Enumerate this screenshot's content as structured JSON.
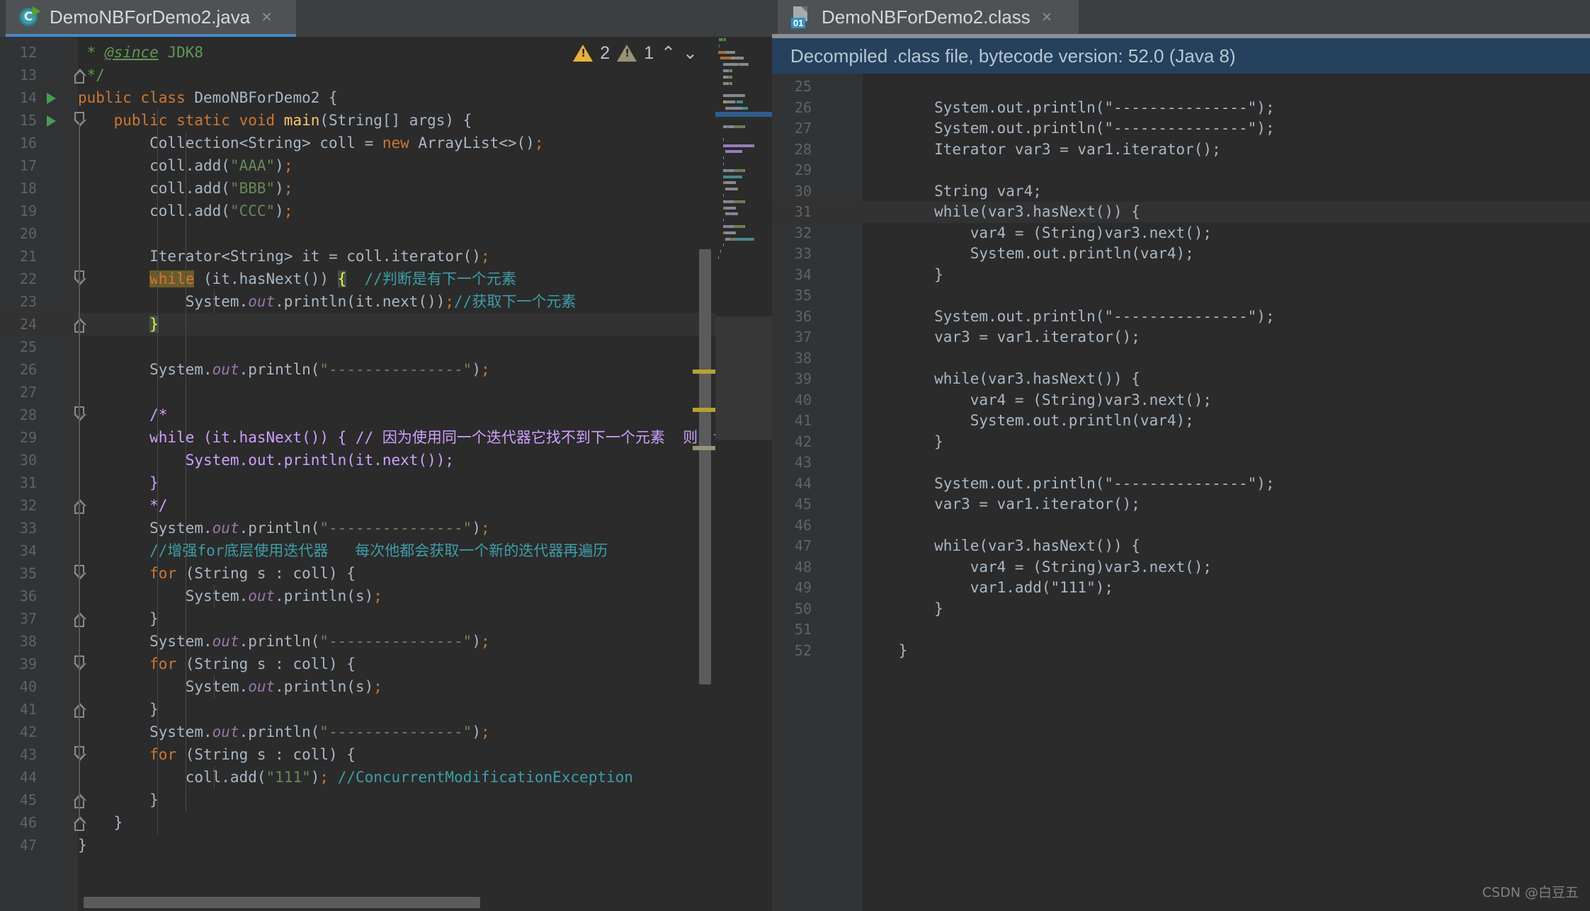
{
  "left": {
    "tab": {
      "label": "DemoNBForDemo2.java",
      "icon": "java-class-icon",
      "close": "×"
    },
    "warnings": {
      "error_count": "2",
      "weak_count": "1",
      "up": "⌃",
      "down": "⌄"
    },
    "first_line_number": 12,
    "lines": [
      {
        "n": 12,
        "frag": [
          {
            "t": " * ",
            "c": "doc"
          },
          {
            "t": "@since",
            "c": "doctag"
          },
          {
            "t": " JDK8",
            "c": "doc"
          }
        ]
      },
      {
        "n": 13,
        "frag": [
          {
            "t": " */",
            "c": "doc"
          }
        ],
        "fold": "arrowup"
      },
      {
        "n": 14,
        "frag": [
          {
            "t": "public class ",
            "c": "kw"
          },
          {
            "t": "DemoNBForDemo2 {",
            "c": "cls"
          }
        ],
        "run": true
      },
      {
        "n": 15,
        "frag": [
          {
            "t": "    ",
            "c": "cls"
          },
          {
            "t": "public static void ",
            "c": "kw"
          },
          {
            "t": "main",
            "c": "mth"
          },
          {
            "t": "(String[] args) {",
            "c": "cls"
          }
        ],
        "run": true,
        "fold": "arrowdown"
      },
      {
        "n": 16,
        "frag": [
          {
            "t": "        Collection<String> coll = ",
            "c": "cls"
          },
          {
            "t": "new ",
            "c": "kw"
          },
          {
            "t": "ArrayList<>()",
            "c": "cls"
          },
          {
            "t": ";",
            "c": "semi"
          }
        ]
      },
      {
        "n": 17,
        "frag": [
          {
            "t": "        coll.add(",
            "c": "cls"
          },
          {
            "t": "\"AAA\"",
            "c": "str"
          },
          {
            "t": ")",
            "c": "cls"
          },
          {
            "t": ";",
            "c": "semi"
          }
        ]
      },
      {
        "n": 18,
        "frag": [
          {
            "t": "        coll.add(",
            "c": "cls"
          },
          {
            "t": "\"BBB\"",
            "c": "str"
          },
          {
            "t": ")",
            "c": "cls"
          },
          {
            "t": ";",
            "c": "semi"
          }
        ]
      },
      {
        "n": 19,
        "frag": [
          {
            "t": "        coll.add(",
            "c": "cls"
          },
          {
            "t": "\"CCC\"",
            "c": "str"
          },
          {
            "t": ")",
            "c": "cls"
          },
          {
            "t": ";",
            "c": "semi"
          }
        ]
      },
      {
        "n": 20,
        "frag": []
      },
      {
        "n": 21,
        "frag": [
          {
            "t": "        Iterator<String> it = coll.iterator()",
            "c": "cls"
          },
          {
            "t": ";",
            "c": "semi"
          }
        ]
      },
      {
        "n": 22,
        "frag": [
          {
            "t": "        ",
            "c": "cls"
          },
          {
            "t": "while",
            "c": "whilehl"
          },
          {
            "t": " (it.hasNext()) ",
            "c": "cls"
          },
          {
            "t": "{",
            "c": "bracehl"
          },
          {
            "t": "  ",
            "c": "cls"
          },
          {
            "t": "//判断是有下一个元素",
            "c": "cmt2"
          }
        ],
        "fold": "arrowdown"
      },
      {
        "n": 23,
        "frag": [
          {
            "t": "            System.",
            "c": "cls"
          },
          {
            "t": "out",
            "c": "fld"
          },
          {
            "t": ".println(it.next())",
            "c": "cls"
          },
          {
            "t": ";",
            "c": "semi"
          },
          {
            "t": "//获取下一个元素",
            "c": "cmt2"
          }
        ]
      },
      {
        "n": 24,
        "frag": [
          {
            "t": "        ",
            "c": "cls"
          },
          {
            "t": "}",
            "c": "bracehl"
          }
        ],
        "fold": "arrowup",
        "hl": true
      },
      {
        "n": 25,
        "frag": []
      },
      {
        "n": 26,
        "frag": [
          {
            "t": "        System.",
            "c": "cls"
          },
          {
            "t": "out",
            "c": "fld"
          },
          {
            "t": ".println(",
            "c": "cls"
          },
          {
            "t": "\"---------------\"",
            "c": "str"
          },
          {
            "t": ")",
            "c": "cls"
          },
          {
            "t": ";",
            "c": "semi"
          }
        ]
      },
      {
        "n": 27,
        "frag": []
      },
      {
        "n": 28,
        "frag": [
          {
            "t": "        /*",
            "c": "cmtblk"
          }
        ],
        "fold": "arrowdown"
      },
      {
        "n": 29,
        "frag": [
          {
            "t": "        while (it.hasNext()) { // 因为使用同一个迭代器它找不到下一个元素  则为false",
            "c": "cmtblk"
          }
        ]
      },
      {
        "n": 30,
        "frag": [
          {
            "t": "            System.out.println(it.next());",
            "c": "cmtblk"
          }
        ]
      },
      {
        "n": 31,
        "frag": [
          {
            "t": "        }",
            "c": "cmtblk"
          }
        ]
      },
      {
        "n": 32,
        "frag": [
          {
            "t": "        */",
            "c": "cmtblk"
          }
        ],
        "fold": "arrowup"
      },
      {
        "n": 33,
        "frag": [
          {
            "t": "        System.",
            "c": "cls"
          },
          {
            "t": "out",
            "c": "fld"
          },
          {
            "t": ".println(",
            "c": "cls"
          },
          {
            "t": "\"---------------\"",
            "c": "str"
          },
          {
            "t": ")",
            "c": "cls"
          },
          {
            "t": ";",
            "c": "semi"
          }
        ]
      },
      {
        "n": 34,
        "frag": [
          {
            "t": "        //增强for底层使用迭代器   每次他都会获取一个新的迭代器再遍历",
            "c": "cmt2"
          }
        ]
      },
      {
        "n": 35,
        "frag": [
          {
            "t": "        ",
            "c": "cls"
          },
          {
            "t": "for ",
            "c": "kw"
          },
          {
            "t": "(String s : coll) {",
            "c": "cls"
          }
        ],
        "fold": "arrowdown"
      },
      {
        "n": 36,
        "frag": [
          {
            "t": "            System.",
            "c": "cls"
          },
          {
            "t": "out",
            "c": "fld"
          },
          {
            "t": ".println(s)",
            "c": "cls"
          },
          {
            "t": ";",
            "c": "semi"
          }
        ]
      },
      {
        "n": 37,
        "frag": [
          {
            "t": "        }",
            "c": "cls"
          }
        ],
        "fold": "arrowup"
      },
      {
        "n": 38,
        "frag": [
          {
            "t": "        System.",
            "c": "cls"
          },
          {
            "t": "out",
            "c": "fld"
          },
          {
            "t": ".println(",
            "c": "cls"
          },
          {
            "t": "\"---------------\"",
            "c": "str"
          },
          {
            "t": ")",
            "c": "cls"
          },
          {
            "t": ";",
            "c": "semi"
          }
        ]
      },
      {
        "n": 39,
        "frag": [
          {
            "t": "        ",
            "c": "cls"
          },
          {
            "t": "for ",
            "c": "kw"
          },
          {
            "t": "(String s : coll) {",
            "c": "cls"
          }
        ],
        "fold": "arrowdown"
      },
      {
        "n": 40,
        "frag": [
          {
            "t": "            System.",
            "c": "cls"
          },
          {
            "t": "out",
            "c": "fld"
          },
          {
            "t": ".println(s)",
            "c": "cls"
          },
          {
            "t": ";",
            "c": "semi"
          }
        ]
      },
      {
        "n": 41,
        "frag": [
          {
            "t": "        }",
            "c": "cls"
          }
        ],
        "fold": "arrowup"
      },
      {
        "n": 42,
        "frag": [
          {
            "t": "        System.",
            "c": "cls"
          },
          {
            "t": "out",
            "c": "fld"
          },
          {
            "t": ".println(",
            "c": "cls"
          },
          {
            "t": "\"---------------\"",
            "c": "str"
          },
          {
            "t": ")",
            "c": "cls"
          },
          {
            "t": ";",
            "c": "semi"
          }
        ]
      },
      {
        "n": 43,
        "frag": [
          {
            "t": "        ",
            "c": "cls"
          },
          {
            "t": "for ",
            "c": "kw"
          },
          {
            "t": "(String s : coll) {",
            "c": "cls"
          }
        ],
        "fold": "arrowdown"
      },
      {
        "n": 44,
        "frag": [
          {
            "t": "            coll.add(",
            "c": "cls"
          },
          {
            "t": "\"111\"",
            "c": "str"
          },
          {
            "t": ")",
            "c": "cls"
          },
          {
            "t": "; ",
            "c": "semi"
          },
          {
            "t": "//ConcurrentModificationException",
            "c": "cmt2"
          }
        ]
      },
      {
        "n": 45,
        "frag": [
          {
            "t": "        }",
            "c": "cls"
          }
        ],
        "fold": "arrowup"
      },
      {
        "n": 46,
        "frag": [
          {
            "t": "    }",
            "c": "cls"
          }
        ],
        "fold": "arrowup"
      },
      {
        "n": 47,
        "frag": [
          {
            "t": "}",
            "c": "cls"
          }
        ]
      }
    ]
  },
  "right": {
    "tab": {
      "label": "DemoNBForDemo2.class",
      "icon": "class-file-icon",
      "badge": "01",
      "close": "×"
    },
    "banner": "Decompiled .class file, bytecode version: 52.0 (Java 8)",
    "first_line_number": 25,
    "lines": [
      {
        "n": 25,
        "code": ""
      },
      {
        "n": 26,
        "code": "        System.out.println(\"---------------\");"
      },
      {
        "n": 27,
        "code": "        System.out.println(\"---------------\");"
      },
      {
        "n": 28,
        "code": "        Iterator var3 = var1.iterator();"
      },
      {
        "n": 29,
        "code": ""
      },
      {
        "n": 30,
        "code": "        String var4;"
      },
      {
        "n": 31,
        "code": "        while(var3.hasNext()) {",
        "hl": true
      },
      {
        "n": 32,
        "code": "            var4 = (String)var3.next();"
      },
      {
        "n": 33,
        "code": "            System.out.println(var4);"
      },
      {
        "n": 34,
        "code": "        }"
      },
      {
        "n": 35,
        "code": ""
      },
      {
        "n": 36,
        "code": "        System.out.println(\"---------------\");"
      },
      {
        "n": 37,
        "code": "        var3 = var1.iterator();"
      },
      {
        "n": 38,
        "code": ""
      },
      {
        "n": 39,
        "code": "        while(var3.hasNext()) {"
      },
      {
        "n": 40,
        "code": "            var4 = (String)var3.next();"
      },
      {
        "n": 41,
        "code": "            System.out.println(var4);"
      },
      {
        "n": 42,
        "code": "        }"
      },
      {
        "n": 43,
        "code": ""
      },
      {
        "n": 44,
        "code": "        System.out.println(\"---------------\");"
      },
      {
        "n": 45,
        "code": "        var3 = var1.iterator();"
      },
      {
        "n": 46,
        "code": ""
      },
      {
        "n": 47,
        "code": "        while(var3.hasNext()) {"
      },
      {
        "n": 48,
        "code": "            var4 = (String)var3.next();"
      },
      {
        "n": 49,
        "code": "            var1.add(\"111\");"
      },
      {
        "n": 50,
        "code": "        }"
      },
      {
        "n": 51,
        "code": ""
      },
      {
        "n": 52,
        "code": "    }"
      }
    ]
  },
  "watermark": "CSDN @白豆五",
  "colors": {
    "accent_tab_underline": "#4a88c7",
    "banner_bg": "#25415e",
    "warning_yellow": "#e8b33a",
    "warning_gray": "#9a9274",
    "badge_blue": "#3592c4",
    "editor_bg": "#2b2b2b",
    "gutter_bg": "#313335",
    "chrome_bg": "#3c3f41"
  }
}
